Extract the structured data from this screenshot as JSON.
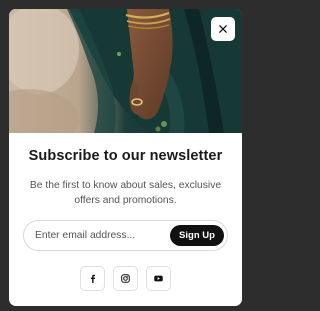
{
  "modal": {
    "hero_image": "woman-hand-bracelets-green-dress-photo",
    "close_icon": "close-icon",
    "title": "Subscribe to our newsletter",
    "subtitle": "Be the first to know about sales, exclusive offers and promotions."
  },
  "form": {
    "email_placeholder": "Enter email address...",
    "email_value": "",
    "submit_label": "Sign Up"
  },
  "social": [
    {
      "name": "facebook",
      "icon": "facebook-icon"
    },
    {
      "name": "instagram",
      "icon": "instagram-icon"
    },
    {
      "name": "youtube",
      "icon": "youtube-icon"
    }
  ],
  "colors": {
    "backdrop": "#2d2d2d",
    "button": "#111111",
    "text": "#1a1a1a",
    "muted": "#555555"
  }
}
